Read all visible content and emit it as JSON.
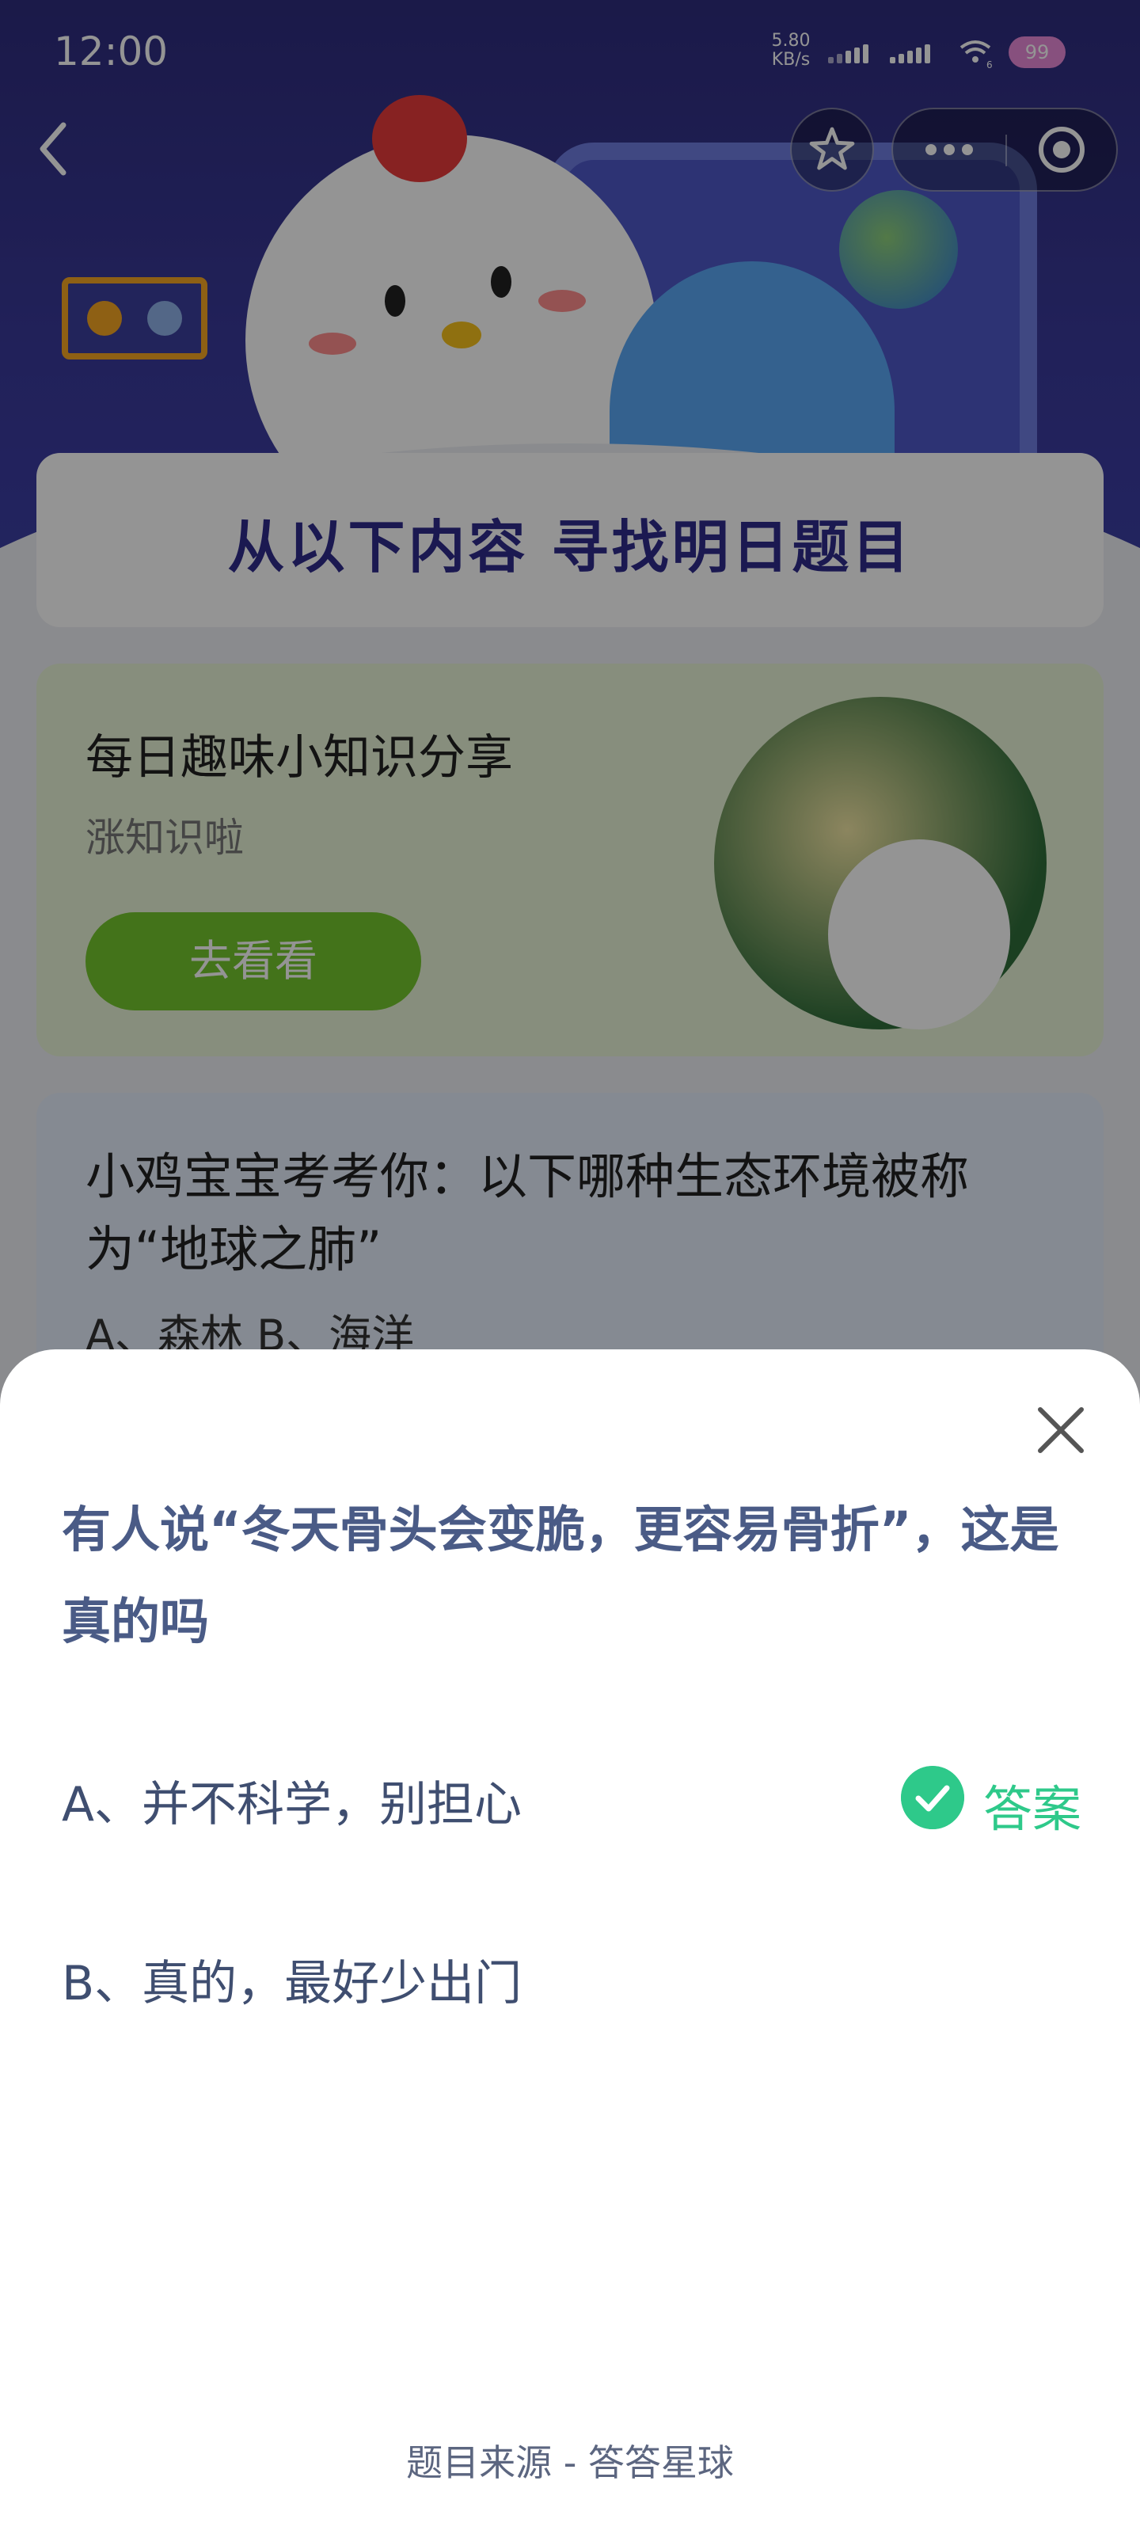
{
  "status_bar": {
    "time": "12:00",
    "net_speed_value": "5.80",
    "net_speed_unit": "KB/s",
    "signal_badge": "6",
    "battery": "99"
  },
  "nav": {
    "back_icon": "chevron-left-icon",
    "favorite_icon": "star-icon",
    "more_icon": "more-dots-icon",
    "close_icon": "target-icon"
  },
  "page": {
    "banner_title": "从以下内容  寻找明日题目",
    "share_card": {
      "title": "每日趣味小知识分享",
      "subtitle": "涨知识啦",
      "button_label": "去看看"
    },
    "quiz_card": {
      "title": "小鸡宝宝考考你：以下哪种生态环境被称为“地球之肺”",
      "options": "A、森林    B、海洋"
    }
  },
  "sheet": {
    "question": "有人说“冬天骨头会变脆，更容易骨折”，这是真的吗",
    "options": [
      {
        "label": "A、并不科学，别担心",
        "is_answer": true
      },
      {
        "label": "B、真的，最好少出门",
        "is_answer": false
      }
    ],
    "answer_label": "答案",
    "footer": "题目来源 - 答答星球"
  },
  "colors": {
    "accent_green": "#2ec98a",
    "question_text": "#4a5b86",
    "hero_bg": "#2f2d7e"
  }
}
